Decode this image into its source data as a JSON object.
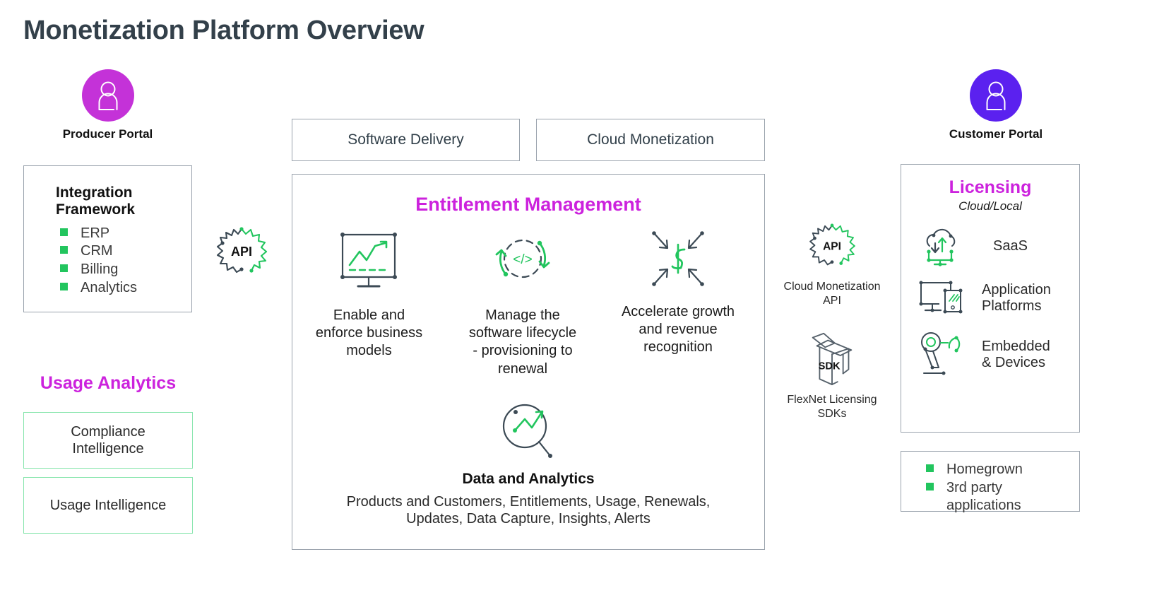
{
  "page": {
    "title": "Monetization Platform Overview",
    "title_color": "#33404a",
    "accent_magenta": "#cc22dd",
    "accent_green": "#22c55e",
    "border_gray": "#9aa3ad"
  },
  "producer_portal": {
    "label": "Producer Portal",
    "avatar_color": "#c432d8",
    "icon": "user-avatar-icon"
  },
  "customer_portal": {
    "label": "Customer Portal",
    "avatar_color": "#5b21ef",
    "icon": "user-avatar-icon"
  },
  "integration_framework": {
    "title_line1": "Integration",
    "title_line2": "Framework",
    "items": [
      "ERP",
      "CRM",
      "Billing",
      "Analytics"
    ]
  },
  "api_connector_left": {
    "label": "API",
    "icon": "api-gear-icon"
  },
  "usage_analytics": {
    "heading": "Usage Analytics",
    "boxes": [
      {
        "label": "Compliance\nIntelligence"
      },
      {
        "label": "Usage Intelligence"
      }
    ]
  },
  "tabs": [
    {
      "label": "Software Delivery"
    },
    {
      "label": "Cloud Monetization"
    }
  ],
  "entitlement": {
    "heading": "Entitlement Management",
    "features": [
      {
        "icon": "chart-monitor-icon",
        "text": "Enable and\nenforce business\nmodels"
      },
      {
        "icon": "code-lifecycle-icon",
        "text": "Manage the\nsoftware lifecycle\n- provisioning to\nrenewal"
      },
      {
        "icon": "revenue-arrows-icon",
        "text": "Accelerate growth\nand revenue\nrecognition"
      }
    ],
    "analytics": {
      "icon": "magnifier-chart-icon",
      "title": "Data and Analytics",
      "subtitle_line1": "Products and Customers, Entitlements, Usage, Renewals,",
      "subtitle_line2": "Updates, Data Capture, Insights, Alerts"
    }
  },
  "right_connectors": [
    {
      "icon": "api-gear-icon",
      "badge": "API",
      "caption_line1": "Cloud Monetization",
      "caption_line2": "API"
    },
    {
      "icon": "sdk-box-icon",
      "badge": "SDK",
      "caption_line1": "FlexNet Licensing",
      "caption_line2": "SDKs"
    }
  ],
  "licensing": {
    "heading": "Licensing",
    "subheading": "Cloud/Local",
    "rows": [
      {
        "icon": "cloud-sync-icon",
        "label": "SaaS"
      },
      {
        "icon": "monitor-device-icon",
        "label": "Application\nPlatforms"
      },
      {
        "icon": "embedded-device-icon",
        "label": "Embedded\n& Devices"
      }
    ]
  },
  "applications_box": {
    "items": [
      "Homegrown",
      "3rd party\napplications"
    ]
  }
}
